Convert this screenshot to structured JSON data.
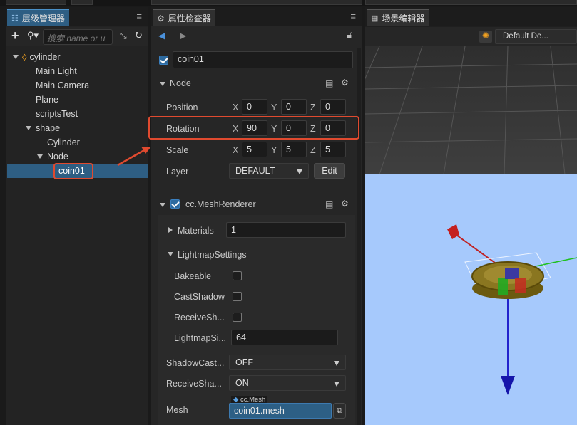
{
  "hierarchy": {
    "tab_title": "层级管理器",
    "search_placeholder": "搜索 name or u",
    "tree": [
      {
        "label": "cylinder",
        "level": 0,
        "expanded": true
      },
      {
        "label": "Main Light",
        "level": 1
      },
      {
        "label": "Main Camera",
        "level": 1
      },
      {
        "label": "Plane",
        "level": 1
      },
      {
        "label": "scriptsTest",
        "level": 1
      },
      {
        "label": "shape",
        "level": 1,
        "expanded": true
      },
      {
        "label": "Cylinder",
        "level": 2
      },
      {
        "label": "Node",
        "level": 2,
        "expanded": true
      },
      {
        "label": "coin01",
        "level": 3,
        "selected": true
      }
    ]
  },
  "inspector": {
    "tab_title": "属性检查器",
    "node_name": "coin01",
    "node_section": "Node",
    "position_label": "Position",
    "position": {
      "x": "0",
      "y": "0",
      "z": "0"
    },
    "rotation_label": "Rotation",
    "rotation": {
      "x": "90",
      "y": "0",
      "z": "0"
    },
    "scale_label": "Scale",
    "scale": {
      "x": "5",
      "y": "5",
      "z": "5"
    },
    "axis_labels": {
      "x": "X",
      "y": "Y",
      "z": "Z"
    },
    "layer_label": "Layer",
    "layer_value": "DEFAULT",
    "edit_label": "Edit",
    "component_title": "cc.MeshRenderer",
    "materials_label": "Materials",
    "materials_value": "1",
    "lightmap_label": "LightmapSettings",
    "bakeable_label": "Bakeable",
    "castshadow_label": "CastShadow",
    "receiveshadow_label": "ReceiveSh...",
    "lightmapsize_label": "LightmapSi...",
    "lightmapsize_value": "64",
    "shadowcast_label": "ShadowCast...",
    "shadowcast_value": "OFF",
    "receiveshadow2_label": "ReceiveSha...",
    "receiveshadow2_value": "ON",
    "mesh_label": "Mesh",
    "mesh_type": "cc.Mesh",
    "mesh_value": "coin01.mesh"
  },
  "scene": {
    "tab_title": "场景编辑器",
    "camera_select": "Default De..."
  },
  "colors": {
    "accent": "#2e5e83",
    "highlight": "#e04a2f",
    "ground": "#a6c9fc"
  }
}
